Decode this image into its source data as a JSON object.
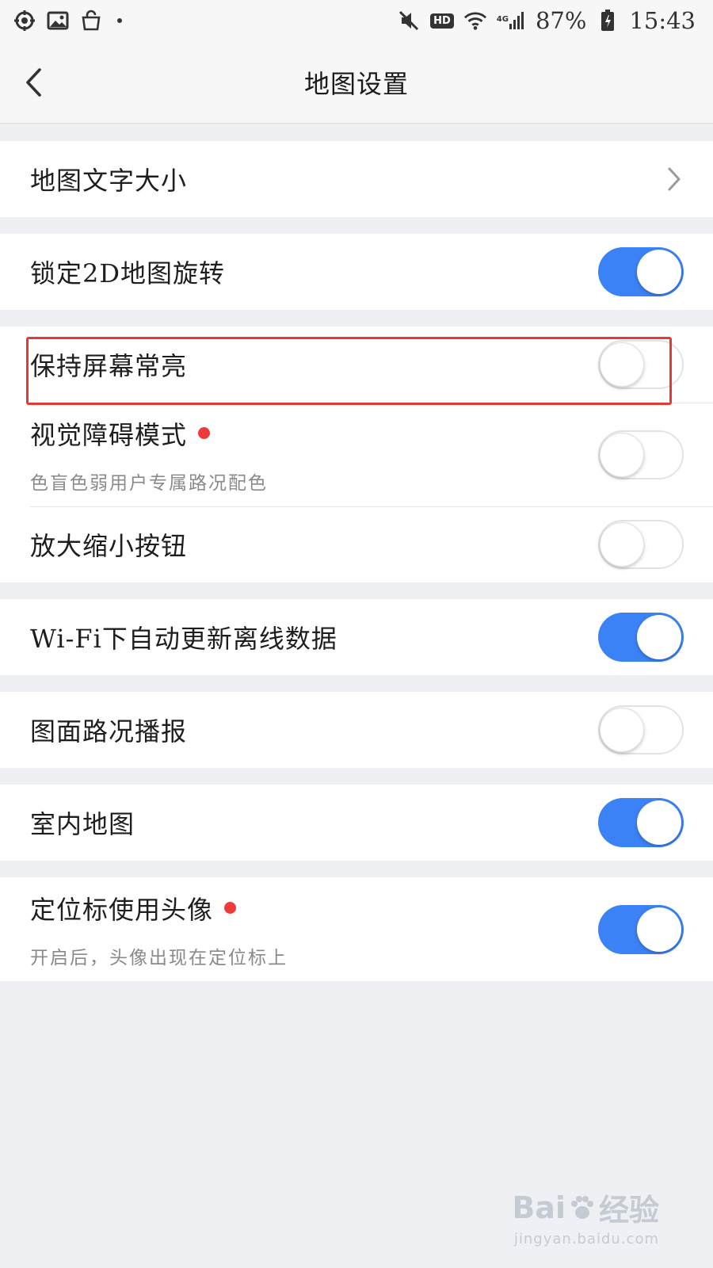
{
  "status_bar": {
    "left_icons": [
      "location-target-icon",
      "image-icon",
      "shopping-bag-icon",
      "dot-icon"
    ],
    "right_icons": [
      "mute-icon",
      "hd-icon",
      "wifi-icon",
      "signal-icon",
      "battery-charging-icon"
    ],
    "hd_label": "HD",
    "network_label": "4G",
    "battery": "87%",
    "time": "15:43"
  },
  "nav": {
    "title": "地图设置",
    "back_icon": "chevron-left-icon"
  },
  "settings": {
    "text_size": {
      "label": "地图文字大小",
      "icon": "chevron-right-icon"
    },
    "lock_2d_rotation": {
      "label": "锁定2D地图旋转",
      "enabled": true
    },
    "keep_screen_on": {
      "label": "保持屏幕常亮",
      "enabled": false,
      "highlighted": true
    },
    "accessibility_mode": {
      "label": "视觉障碍模式",
      "sub": "色盲色弱用户专属路况配色",
      "enabled": false,
      "new_badge": true
    },
    "zoom_buttons": {
      "label": "放大缩小按钮",
      "enabled": false
    },
    "wifi_auto_update": {
      "label": "Wi-Fi下自动更新离线数据",
      "enabled": true
    },
    "traffic_broadcast": {
      "label": "图面路况播报",
      "enabled": false
    },
    "indoor_map": {
      "label": "室内地图",
      "enabled": true
    },
    "avatar_location": {
      "label": "定位标使用头像",
      "sub": "开启后，头像出现在定位标上",
      "enabled": true,
      "new_badge": true
    }
  },
  "colors": {
    "toggle_on": "#3b82f6",
    "highlight_border": "#e53935",
    "badge_red": "#f03a3a"
  },
  "watermark": {
    "main": "Bai",
    "main_suffix": "经验",
    "sub": "jingyan.baidu.com"
  }
}
